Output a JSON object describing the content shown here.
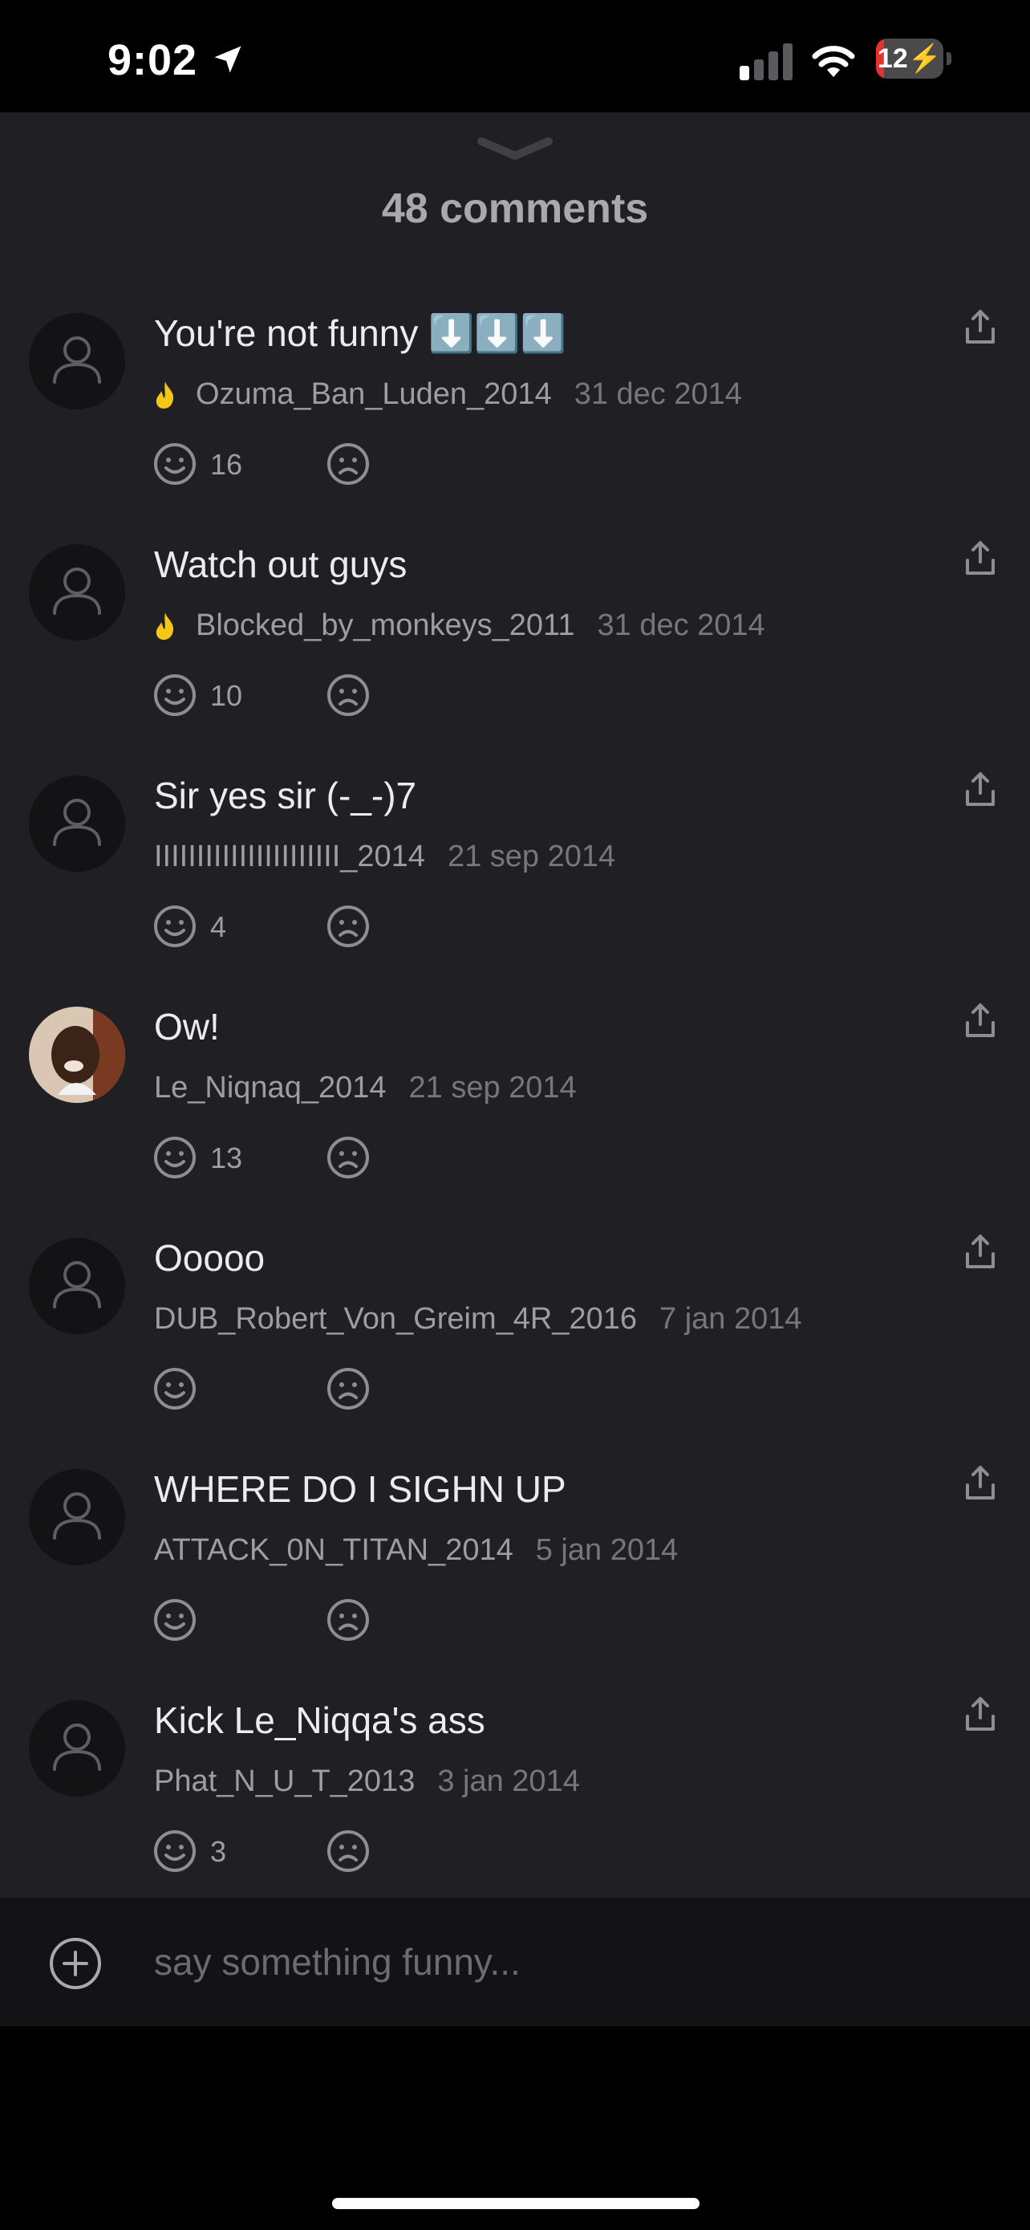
{
  "status_bar": {
    "time": "9:02",
    "battery": "12",
    "battery_level": 0.12,
    "battery_color": "#e5322d"
  },
  "sheet": {
    "title": "48 comments"
  },
  "comments": [
    {
      "text": "You're not funny ⬇️⬇️⬇️",
      "author": "Ozuma_Ban_Luden_2014",
      "date": "31 dec 2014",
      "likes": "16",
      "flame": true,
      "avatar": "default"
    },
    {
      "text": "Watch out guys",
      "author": "Blocked_by_monkeys_2011",
      "date": "31 dec 2014",
      "likes": "10",
      "flame": true,
      "avatar": "default"
    },
    {
      "text": "Sir yes sir (-_-)7",
      "author": "IIIIIIIIIIIIIIIIIIIIII_2014",
      "date": "21 sep 2014",
      "likes": "4",
      "flame": false,
      "avatar": "default"
    },
    {
      "text": "Ow!",
      "author": "Le_Niqnaq_2014",
      "date": "21 sep 2014",
      "likes": "13",
      "flame": false,
      "avatar": "photo"
    },
    {
      "text": "Ooooo",
      "author": "DUB_Robert_Von_Greim_4R_2016",
      "date": "7 jan 2014",
      "likes": "",
      "flame": false,
      "avatar": "default"
    },
    {
      "text": "WHERE DO I SIGHN UP",
      "author": "ATTACK_0N_TITAN_2014",
      "date": "5 jan 2014",
      "likes": "",
      "flame": false,
      "avatar": "default"
    },
    {
      "text": "Kick Le_Niqqa's ass",
      "author": "Phat_N_U_T_2013",
      "date": "3 jan 2014",
      "likes": "3",
      "flame": false,
      "avatar": "default"
    }
  ],
  "composer": {
    "placeholder": "say something funny..."
  },
  "colors": {
    "sheet_bg": "#1f1f24",
    "flame": "#f5c518"
  }
}
